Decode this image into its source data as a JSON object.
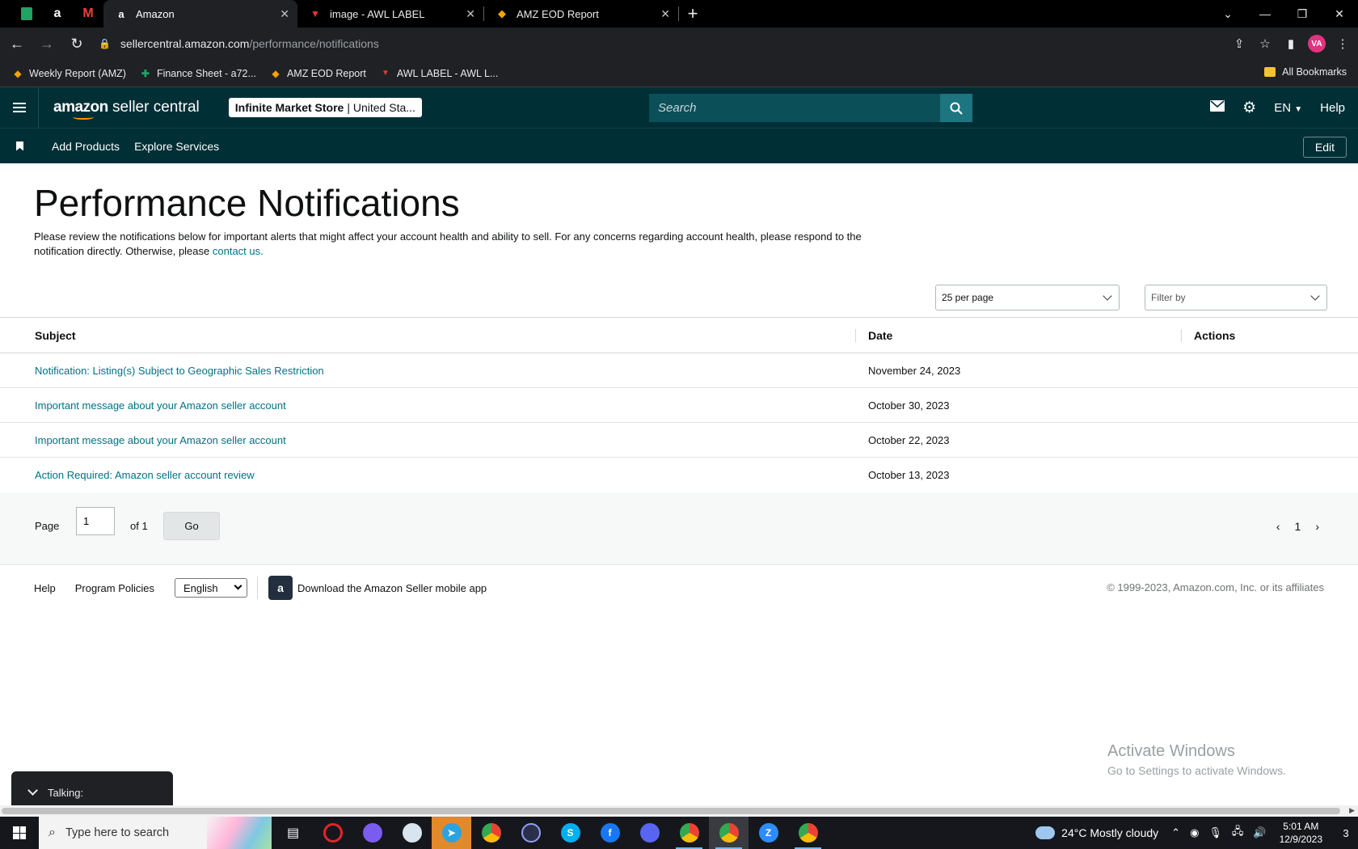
{
  "browser": {
    "tabs": [
      {
        "title": "Amazon",
        "active": true
      },
      {
        "title": "image - AWL LABEL",
        "active": false
      },
      {
        "title": "AMZ EOD Report",
        "active": false
      }
    ],
    "url_domain": "sellercentral.amazon.com",
    "url_path": "/performance/notifications",
    "profile_initials": "VA",
    "bookmarks": [
      {
        "label": "Weekly Report (AMZ)",
        "icon": "multicolor-icon"
      },
      {
        "label": "Finance Sheet - a72...",
        "icon": "sheets-icon"
      },
      {
        "label": "AMZ EOD Report",
        "icon": "multicolor-icon"
      },
      {
        "label": "AWL LABEL - AWL L...",
        "icon": "awl-icon"
      }
    ],
    "all_bookmarks": "All Bookmarks"
  },
  "header": {
    "logo_brand": "amazon",
    "logo_product": "seller central",
    "store_name": "Infinite Market Store",
    "store_region": "| United Sta...",
    "search_placeholder": "Search",
    "language": "EN",
    "help": "Help"
  },
  "subnav": {
    "links": [
      "Add Products",
      "Explore Services"
    ],
    "edit": "Edit"
  },
  "page": {
    "title": "Performance Notifications",
    "intro": "Please review the notifications below for important alerts that might affect your account health and ability to sell. For any concerns regarding account health, please respond to the notification directly. Otherwise, please",
    "contact_link": "contact us."
  },
  "controls": {
    "per_page": "25 per page",
    "filter_placeholder": "Filter by"
  },
  "table": {
    "headers": {
      "subject": "Subject",
      "date": "Date",
      "actions": "Actions"
    },
    "rows": [
      {
        "subject": "Notification: Listing(s) Subject to Geographic Sales Restriction",
        "date": "November 24, 2023"
      },
      {
        "subject": "Important message about your Amazon seller account",
        "date": "October 30, 2023"
      },
      {
        "subject": "Important message about your Amazon seller account",
        "date": "October 22, 2023"
      },
      {
        "subject": "Action Required: Amazon seller account review",
        "date": "October 13, 2023"
      }
    ]
  },
  "pagination": {
    "page_label": "Page",
    "page_value": "1",
    "of_label": "of 1",
    "go": "Go",
    "current": "1"
  },
  "footer": {
    "help": "Help",
    "policies": "Program Policies",
    "language": "English",
    "app_text": "Download the Amazon Seller mobile app",
    "copyright": "© 1999-2023, Amazon.com, Inc. or its affiliates"
  },
  "overlay": {
    "activate_title": "Activate Windows",
    "activate_sub": "Go to Settings to activate Windows.",
    "talking": "Talking:"
  },
  "taskbar": {
    "search_placeholder": "Type here to search",
    "weather": "24°C  Mostly cloudy",
    "time": "5:01 AM",
    "date": "12/9/2023",
    "notifications": "3"
  },
  "colors": {
    "header_bg": "#002f36",
    "link": "#007185",
    "search_btn": "#1d7580"
  }
}
